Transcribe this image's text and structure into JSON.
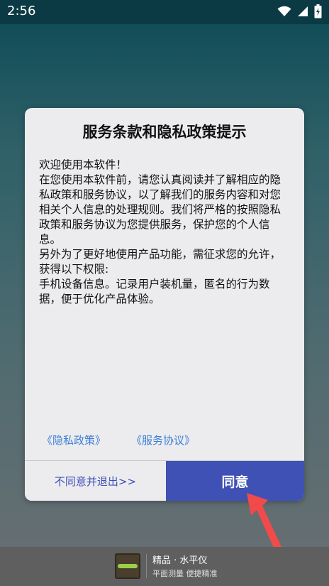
{
  "status_bar": {
    "time": "2:56"
  },
  "dialog": {
    "title": "服务条款和隐私政策提示",
    "body": "欢迎使用本软件！\n在您使用本软件前，请您认真阅读并了解相应的隐私政策和服务协议，以了解我们的服务内容和对您相关个人信息的处理规则。我们将严格的按照隐私政策和服务协议为您提供服务，保护您的个人信息。\n另外为了更好地使用产品功能，需征求您的允许，获得以下权限:\n手机设备信息。记录用户装机量，匿名的行为数据，便于优化产品体验。",
    "privacy_link": "《隐私政策》",
    "service_link": "《服务协议》",
    "disagree_label": "不同意并退出>>",
    "agree_label": "同意"
  },
  "banner": {
    "title": "精品 · 水平仪",
    "subtitle": "平面测量 便捷精准"
  },
  "colors": {
    "accent": "#3f51b5",
    "link": "#3b7ed6",
    "arrow": "#f04a4a"
  }
}
